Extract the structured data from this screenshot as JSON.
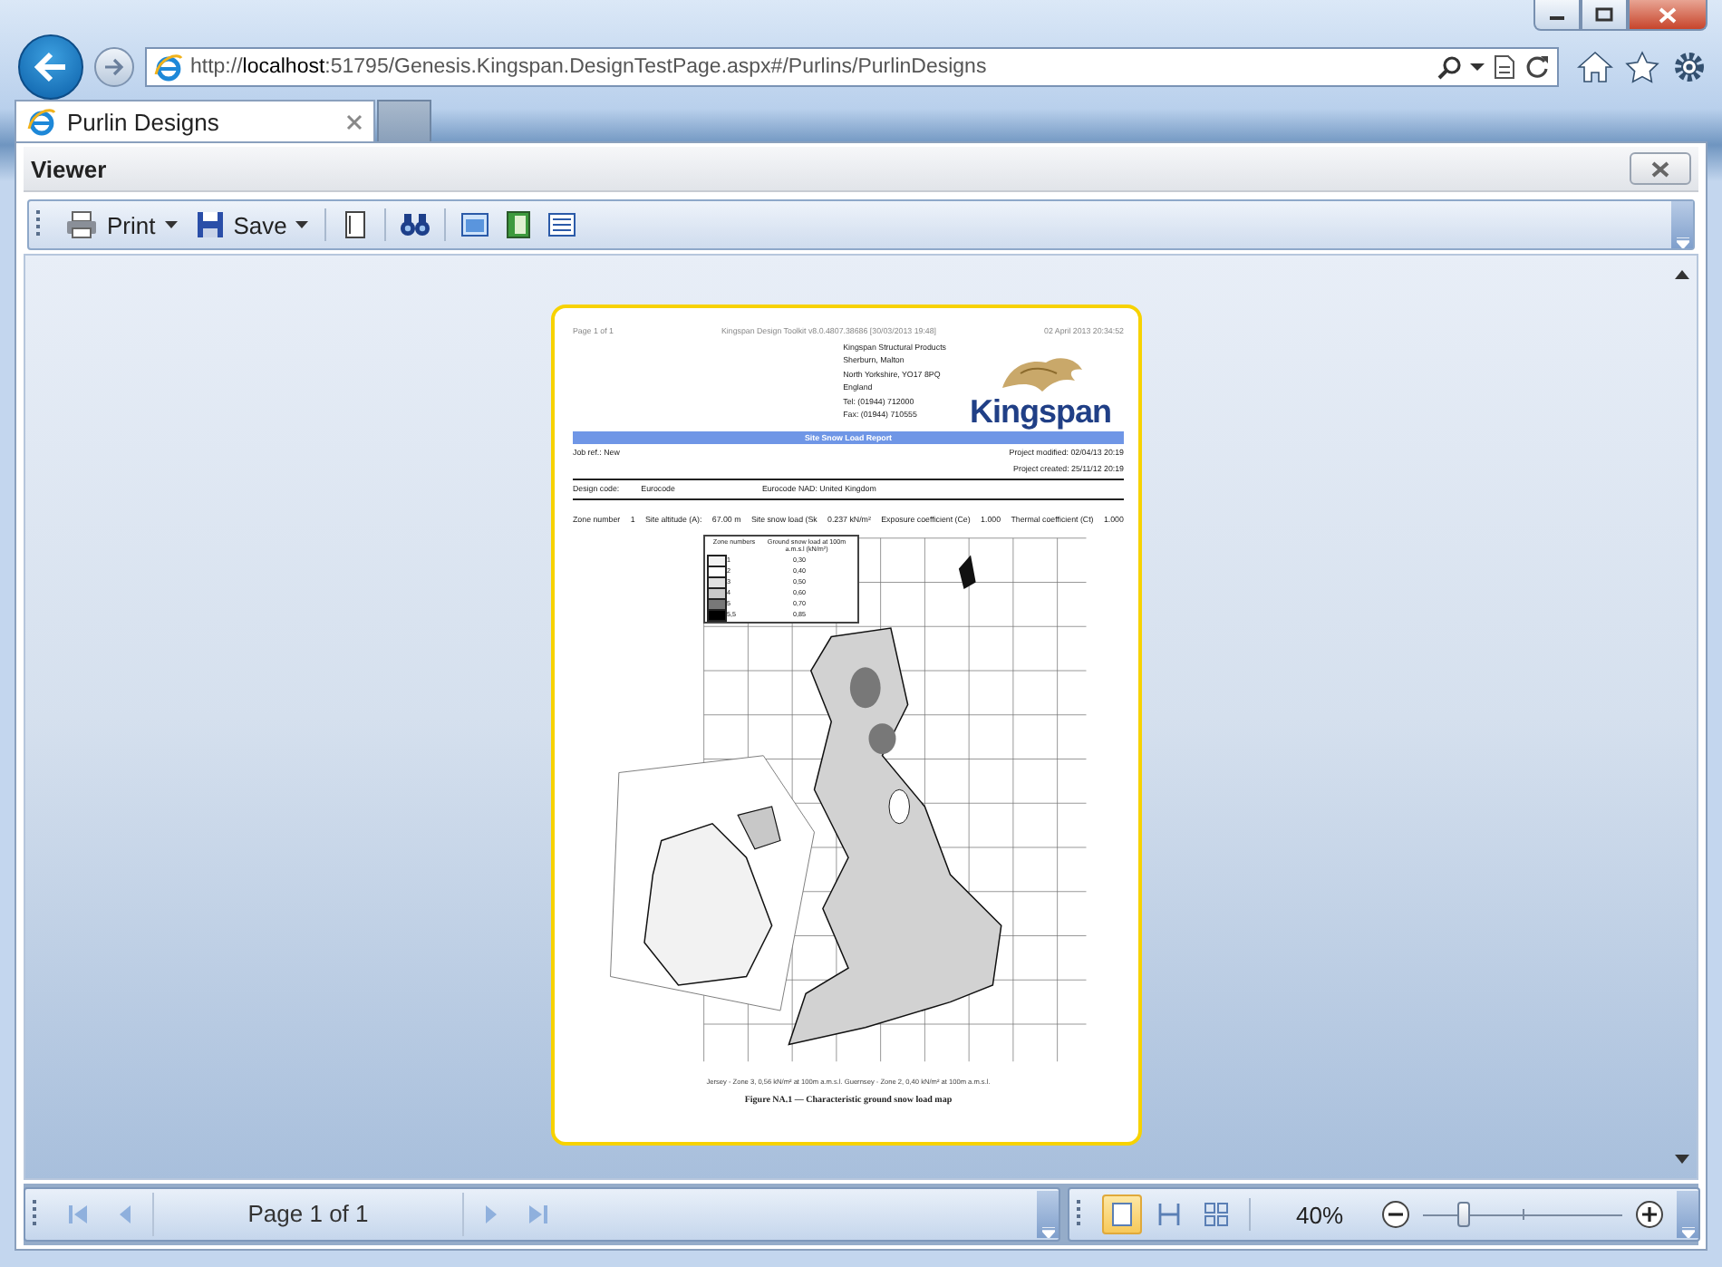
{
  "browser": {
    "address": "http://**localhost**:51795/Genesis.Kingspan.DesignTestPage.aspx#/Purlins/PurlinDesigns"
  },
  "tabs": [
    {
      "label": "Purlin Designs",
      "selected": true
    }
  ],
  "panel": {
    "title": "Viewer"
  },
  "toolbar": {
    "print": "Print",
    "save": "Save"
  },
  "report": {
    "page_label": "Page 1 of 1",
    "toolkit": "Kingspan Design Toolkit v8.0.4807.38686 [30/03/2013 19:48]",
    "printed": "02 April 2013 20:34:52",
    "address": [
      "Kingspan Structural Products",
      "Sherburn, Malton",
      "North Yorkshire, YO17 8PQ",
      "England",
      "Tel: (01944) 712000",
      "Fax: (01944) 710555"
    ],
    "logo": "Kingspan",
    "title": "Site Snow Load Report",
    "job_ref": "Job ref.: New",
    "modified": "Project modified: 02/04/13 20:19",
    "created": "Project created: 25/11/12 20:19",
    "design_code_label": "Design code:",
    "design_code": "Eurocode",
    "nad": "Eurocode NAD: United Kingdom",
    "params": [
      "Zone number",
      "1",
      "Site altitude (A):",
      "67.00 m",
      "Site snow load (Sk",
      "0.237 kN/m²",
      "Exposure coefficient (Ce)",
      "1.000",
      "Thermal coefficient (Ct)",
      "1.000"
    ],
    "legend": {
      "col1": "Zone numbers",
      "col2": "Ground snow load at 100m a.m.s.l (kN/m²)",
      "rows": [
        {
          "zone": "1",
          "load": "0,30",
          "color": "#f2f2f2"
        },
        {
          "zone": "2",
          "load": "0,40",
          "color": "#ffffff"
        },
        {
          "zone": "3",
          "load": "0,50",
          "color": "#e0e0e0"
        },
        {
          "zone": "4",
          "load": "0,60",
          "color": "#c8c8c8"
        },
        {
          "zone": "5",
          "load": "0,70",
          "color": "#787878"
        },
        {
          "zone": "5,5",
          "load": "0,85",
          "color": "#000000"
        }
      ]
    },
    "note": "Jersey - Zone 3, 0,56 kN/m² at 100m a.m.s.l. Guernsey - Zone 2, 0,40 kN/m² at 100m a.m.s.l.",
    "caption": "Figure NA.1 — Characteristic ground snow load map"
  },
  "pager": {
    "text": "Page 1 of 1"
  },
  "view_modes": [
    {
      "selected": true
    },
    {
      "selected": false
    },
    {
      "selected": false
    }
  ],
  "zoom": {
    "reading": "40%",
    "level": 0.2
  }
}
